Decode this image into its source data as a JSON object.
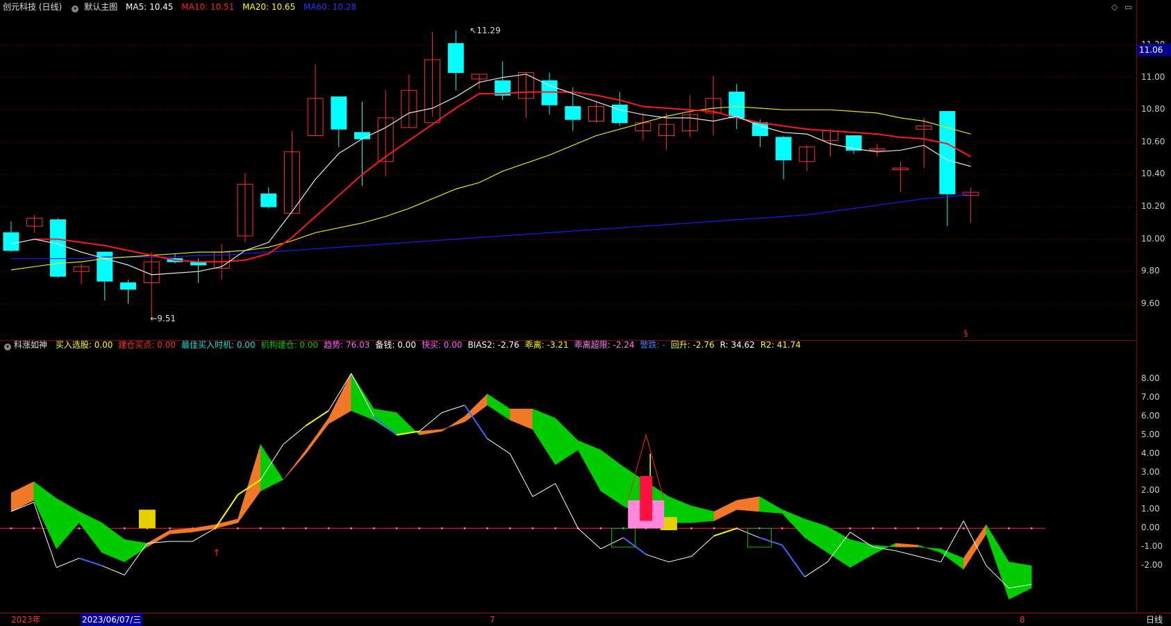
{
  "header_main": {
    "stock": "创元科技 (日线)",
    "template": "默认主图",
    "ma5": "MA5: 10.45",
    "ma10": "MA10: 10.51",
    "ma20": "MA20: 10.65",
    "ma60": "MA60: 10.28"
  },
  "header_sub": {
    "name": "科涨如神",
    "items": [
      {
        "text": "买入选股: 0.00",
        "color": "#ffff00"
      },
      {
        "text": "建仓买点: 0.00",
        "color": "#ff3030"
      },
      {
        "text": "最佳买入时机: 0.00",
        "color": "#00e5e5"
      },
      {
        "text": "机构建仓: 0.00",
        "color": "#00cc00"
      },
      {
        "text": "趋势: 76.03",
        "color": "#ff60ff"
      },
      {
        "text": "备钱: 0.00",
        "color": "#ffffff"
      },
      {
        "text": "快买: 0.00",
        "color": "#ff60ff"
      },
      {
        "text": "BIAS2: -2.76",
        "color": "#ffffff"
      },
      {
        "text": "乖离: -3.21",
        "color": "#ffff00"
      },
      {
        "text": "乖离超限: -2.24",
        "color": "#ff80ff"
      },
      {
        "text": "警跌: -",
        "color": "#4a7bff"
      },
      {
        "text": "回升: -2.76",
        "color": "#ffff00"
      },
      {
        "text": "R: 34.62",
        "color": "#ffffff"
      },
      {
        "text": "R2: 41.74",
        "color": "#ffff00"
      }
    ]
  },
  "price_axis": [
    "11.20",
    "11.00",
    "10.80",
    "10.60",
    "10.40",
    "10.20",
    "10.00",
    "9.80",
    "9.60"
  ],
  "current_price": "11.06",
  "sub_axis": [
    "8.00",
    "7.00",
    "6.00",
    "5.00",
    "4.00",
    "3.00",
    "2.00",
    "1.00",
    "0.00",
    "-1.00",
    "-2.00"
  ],
  "annotations": {
    "high": "11.29",
    "low": "9.51"
  },
  "bottom_bar": {
    "year": "2023年",
    "date": "2023/06/07/三",
    "m7": "7",
    "m8": "8",
    "period": "日线"
  },
  "chart_data": {
    "type": "candlestick",
    "ohlc": [
      [
        10.04,
        10.11,
        9.92,
        9.93
      ],
      [
        10.08,
        10.15,
        10.04,
        10.13
      ],
      [
        10.12,
        10.13,
        9.76,
        9.77
      ],
      [
        9.8,
        9.85,
        9.72,
        9.83
      ],
      [
        9.92,
        9.92,
        9.62,
        9.74
      ],
      [
        9.73,
        9.75,
        9.6,
        9.69
      ],
      [
        9.73,
        9.92,
        9.51,
        9.86
      ],
      [
        9.88,
        9.91,
        9.85,
        9.86
      ],
      [
        9.86,
        9.88,
        9.73,
        9.84
      ],
      [
        9.82,
        9.97,
        9.75,
        9.92
      ],
      [
        10.02,
        10.41,
        9.98,
        10.34
      ],
      [
        10.28,
        10.32,
        10.19,
        10.2
      ],
      [
        10.16,
        10.67,
        10.16,
        10.54
      ],
      [
        10.64,
        11.08,
        10.64,
        10.87
      ],
      [
        10.88,
        10.87,
        10.57,
        10.68
      ],
      [
        10.66,
        10.85,
        10.33,
        10.62
      ],
      [
        10.48,
        10.92,
        10.39,
        10.75
      ],
      [
        10.69,
        11.02,
        10.69,
        10.92
      ],
      [
        10.72,
        11.28,
        10.76,
        11.11
      ],
      [
        11.21,
        11.29,
        10.92,
        11.03
      ],
      [
        10.99,
        11.02,
        10.93,
        11.02
      ],
      [
        10.98,
        11.1,
        10.86,
        10.89
      ],
      [
        10.87,
        11.03,
        10.75,
        11.03
      ],
      [
        10.98,
        11.03,
        10.77,
        10.83
      ],
      [
        10.82,
        10.94,
        10.67,
        10.74
      ],
      [
        10.73,
        10.85,
        10.72,
        10.82
      ],
      [
        10.83,
        10.91,
        10.7,
        10.72
      ],
      [
        10.67,
        10.78,
        10.61,
        10.72
      ],
      [
        10.64,
        10.78,
        10.55,
        10.71
      ],
      [
        10.67,
        10.89,
        10.63,
        10.77
      ],
      [
        10.78,
        11.01,
        10.64,
        10.87
      ],
      [
        10.91,
        10.96,
        10.68,
        10.75
      ],
      [
        10.72,
        10.74,
        10.57,
        10.64
      ],
      [
        10.63,
        10.64,
        10.37,
        10.49
      ],
      [
        10.48,
        10.58,
        10.42,
        10.57
      ],
      [
        10.61,
        10.68,
        10.51,
        10.67
      ],
      [
        10.64,
        10.62,
        10.53,
        10.55
      ],
      [
        10.55,
        10.59,
        10.51,
        10.56
      ],
      [
        10.43,
        10.48,
        10.29,
        10.44
      ],
      [
        10.68,
        10.75,
        10.44,
        10.7
      ],
      [
        10.79,
        10.79,
        10.08,
        10.28
      ],
      [
        10.27,
        10.32,
        10.1,
        10.29
      ]
    ],
    "ma5": [
      9.97,
      10.0,
      9.97,
      9.92,
      9.88,
      9.84,
      9.78,
      9.79,
      9.8,
      9.83,
      9.93,
      9.98,
      10.17,
      10.37,
      10.53,
      10.62,
      10.69,
      10.78,
      10.81,
      10.88,
      10.97,
      11.0,
      11.02,
      10.95,
      10.9,
      10.85,
      10.8,
      10.77,
      10.75,
      10.75,
      10.73,
      10.76,
      10.7,
      10.66,
      10.65,
      10.59,
      10.56,
      10.54,
      10.55,
      10.58,
      10.49,
      10.45
    ],
    "ma10": [
      10.0,
      10.0,
      9.98,
      9.96,
      9.93,
      9.9,
      9.87,
      9.86,
      9.86,
      9.87,
      9.91,
      10.01,
      10.14,
      10.27,
      10.4,
      10.51,
      10.61,
      10.71,
      10.81,
      10.9,
      10.9,
      10.91,
      10.91,
      10.91,
      10.89,
      10.86,
      10.82,
      10.81,
      10.8,
      10.79,
      10.75,
      10.72,
      10.7,
      10.68,
      10.67,
      10.66,
      10.65,
      10.63,
      10.62,
      10.59,
      10.51
    ],
    "ma20": [
      9.81,
      9.83,
      9.85,
      9.86,
      9.88,
      9.89,
      9.9,
      9.91,
      9.92,
      9.92,
      9.93,
      9.95,
      9.99,
      10.04,
      10.07,
      10.1,
      10.14,
      10.19,
      10.25,
      10.31,
      10.35,
      10.42,
      10.47,
      10.52,
      10.58,
      10.64,
      10.68,
      10.72,
      10.76,
      10.79,
      10.81,
      10.82,
      10.81,
      10.8,
      10.8,
      10.8,
      10.79,
      10.78,
      10.75,
      10.73,
      10.69,
      10.65
    ],
    "ma60": [
      9.88,
      9.88,
      9.88,
      9.88,
      9.89,
      9.89,
      9.89,
      9.89,
      9.9,
      9.9,
      9.91,
      9.92,
      9.93,
      9.94,
      9.95,
      9.96,
      9.97,
      9.98,
      9.99,
      10.0,
      10.01,
      10.02,
      10.03,
      10.04,
      10.05,
      10.06,
      10.07,
      10.08,
      10.09,
      10.1,
      10.11,
      10.12,
      10.13,
      10.14,
      10.15,
      10.17,
      10.19,
      10.21,
      10.23,
      10.25,
      10.26,
      10.28
    ],
    "sub": {
      "upper": [
        1.9,
        2.5,
        1.6,
        0.9,
        0.3,
        -0.6,
        -0.8,
        -0.1,
        0.0,
        0.2,
        0.5,
        4.5,
        2.6,
        4.2,
        5.9,
        8.3,
        6.4,
        6.2,
        5.0,
        5.2,
        6.0,
        7.2,
        6.4,
        6.4,
        5.9,
        4.7,
        4.2,
        3.3,
        2.5,
        1.7,
        1.2,
        0.9,
        1.5,
        1.7,
        1.0,
        0.5,
        0.1,
        -0.6,
        -0.9,
        -1.0,
        -1.0,
        -1.1,
        -1.6,
        0.2,
        -1.8,
        -2.0
      ],
      "lower": [
        0.9,
        1.5,
        -1.1,
        0.3,
        -1.3,
        -1.8,
        -1.0,
        -0.3,
        -0.2,
        0.0,
        0.3,
        2.0,
        2.6,
        4.0,
        5.6,
        6.3,
        5.8,
        5.0,
        5.2,
        5.3,
        5.7,
        6.6,
        5.8,
        5.3,
        3.4,
        4.2,
        2.0,
        1.2,
        0.6,
        0.3,
        0.3,
        0.4,
        1.0,
        0.9,
        0.8,
        -0.5,
        -1.3,
        -2.1,
        -1.4,
        -0.8,
        -0.9,
        -1.3,
        -2.2,
        -0.3,
        -3.8,
        -3.2
      ],
      "white": [
        0.9,
        1.4,
        -2.1,
        -1.6,
        -2.0,
        -2.5,
        -0.8,
        -0.7,
        -0.7,
        0.0,
        1.8,
        2.6,
        4.5,
        5.5,
        6.3,
        8.3,
        6.0,
        5.0,
        5.2,
        6.2,
        6.6,
        4.8,
        4.0,
        1.7,
        2.4,
        0.0,
        -1.1,
        -0.5,
        -1.4,
        -1.8,
        -1.5,
        -0.4,
        0.0,
        -0.5,
        -0.9,
        -2.6,
        -1.8,
        -0.2,
        -1.0,
        -1.2,
        -1.5,
        -1.8,
        0.4,
        -2.0,
        -3.2,
        -3.0
      ]
    }
  }
}
